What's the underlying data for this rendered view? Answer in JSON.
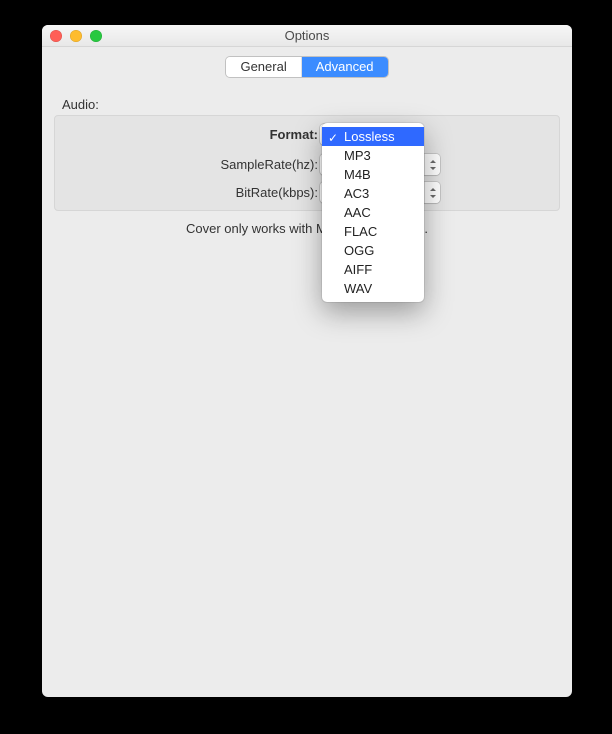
{
  "window": {
    "title": "Options"
  },
  "tabs": {
    "general": "General",
    "advanced": "Advanced",
    "active": "advanced"
  },
  "section": {
    "audio_label": "Audio:"
  },
  "fields": {
    "format": {
      "label": "Format:",
      "value": "Lossless"
    },
    "samplerate": {
      "label": "SampleRate(hz):",
      "value": ""
    },
    "bitrate": {
      "label": "BitRate(kbps):",
      "value": ""
    }
  },
  "note": "Cover only works with M4A and MP3 files.",
  "format_menu": {
    "selected_index": 0,
    "items": [
      "Lossless",
      "MP3",
      "M4B",
      "AC3",
      "AAC",
      "FLAC",
      "OGG",
      "AIFF",
      "WAV"
    ]
  }
}
